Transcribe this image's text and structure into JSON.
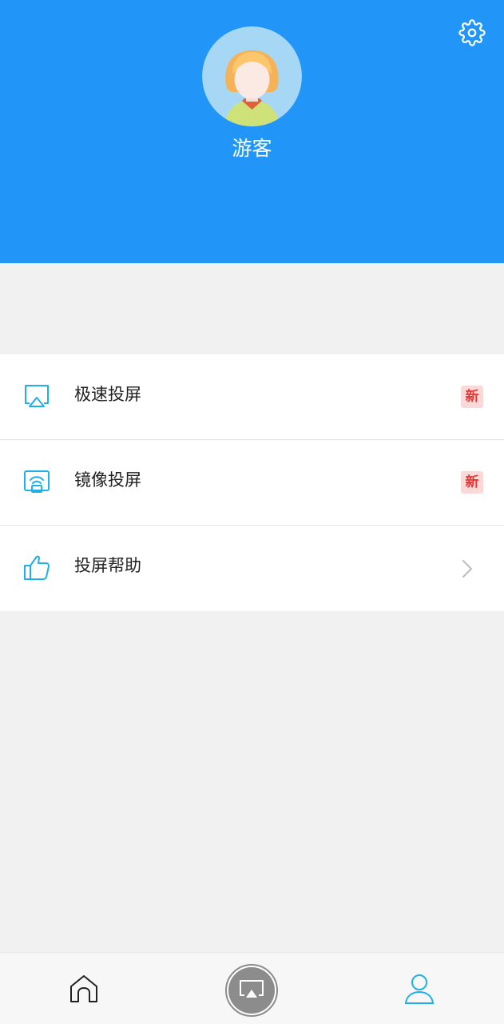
{
  "colors": {
    "header_bg": "#2196f8",
    "accent": "#1fb0e6",
    "badge_text": "#e53935",
    "badge_bg": "#fbd9d9",
    "page_bg": "#f1f1f1",
    "tabbar_bg": "#f7f7f7"
  },
  "profile": {
    "username": "游客",
    "avatar_icon": "avatar-icon"
  },
  "header": {
    "settings_icon": "gear-icon"
  },
  "menu": {
    "items": [
      {
        "icon": "airplay-icon",
        "label": "极速投屏",
        "badge": "新"
      },
      {
        "icon": "mirror-screen-icon",
        "label": "镜像投屏",
        "badge": "新"
      },
      {
        "icon": "thumbs-up-icon",
        "label": "投屏帮助",
        "trailing": "chevron-right-icon"
      }
    ]
  },
  "tabbar": {
    "tabs": [
      {
        "icon": "home-icon",
        "active": false
      },
      {
        "icon": "cast-icon",
        "active": false
      },
      {
        "icon": "profile-icon",
        "active": true
      }
    ]
  }
}
